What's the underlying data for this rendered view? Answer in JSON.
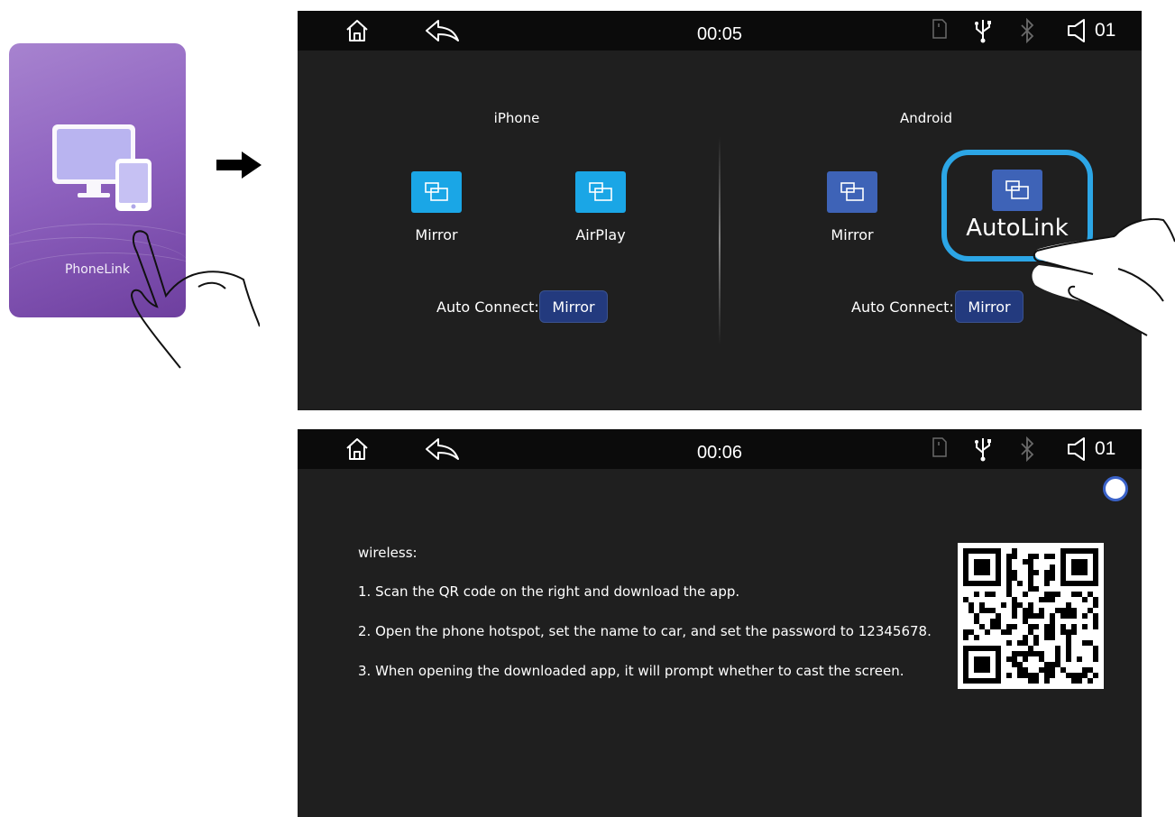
{
  "tile": {
    "label": "PhoneLink",
    "icon": "monitor-phone-icon",
    "gradient": [
      "#a783cf",
      "#6e3f9f"
    ]
  },
  "statusbar_icons": [
    "home-icon",
    "back-icon",
    "sd-card-icon",
    "usb-icon",
    "bluetooth-icon",
    "volume-icon"
  ],
  "screen1": {
    "time": "00:05",
    "volume": "01",
    "iphone": {
      "heading": "iPhone",
      "buttons": [
        {
          "label": "Mirror",
          "color": "#1aa6e6"
        },
        {
          "label": "AirPlay",
          "color": "#1aa6e6"
        }
      ],
      "auto_connect_label": "Auto Connect:",
      "auto_connect_value": "Mirror"
    },
    "android": {
      "heading": "Android",
      "buttons": [
        {
          "label": "Mirror",
          "color": "#3e63b7"
        },
        {
          "label": "AutoLink",
          "color": "#3e63b7",
          "highlighted": true
        }
      ],
      "auto_connect_label": "Auto Connect:",
      "auto_connect_value": "Mirror"
    },
    "highlight_color": "#2ca6e6"
  },
  "screen2": {
    "time": "00:06",
    "volume": "01",
    "instructions": [
      "wireless:",
      "1. Scan the QR code on the right and download the app.",
      "2. Open the phone hotspot, set the name to car, and set the password to 12345678.",
      "3. When opening the downloaded app, it will prompt whether to cast the screen."
    ],
    "qr_icon": "qr-code"
  }
}
